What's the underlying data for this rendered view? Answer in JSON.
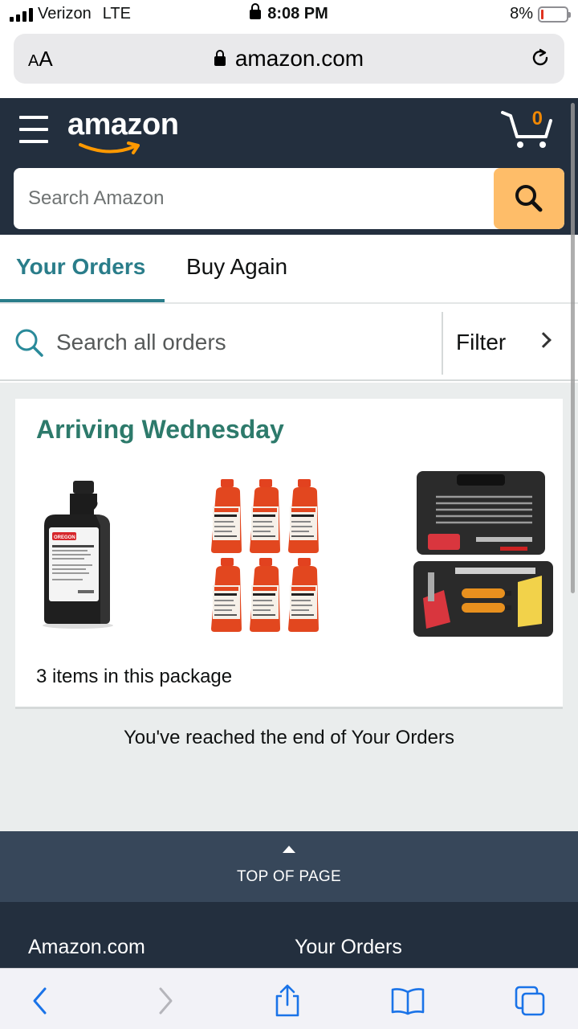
{
  "status_bar": {
    "carrier": "Verizon",
    "network": "LTE",
    "time": "8:08 PM",
    "battery_percent": "8%",
    "battery_level": 0.08
  },
  "browser": {
    "aa_label": "AA",
    "url": "amazon.com",
    "icons": [
      "lock-icon",
      "reload-icon"
    ]
  },
  "header": {
    "logo_text": "amazon",
    "cart_count": "0",
    "search_placeholder": "Search Amazon",
    "colors": {
      "header_bg": "#232f3e",
      "search_button": "#febd69",
      "cart_count": "#f08804"
    }
  },
  "tabs": [
    {
      "label": "Your Orders",
      "active": true
    },
    {
      "label": "Buy Again",
      "active": false
    }
  ],
  "order_search": {
    "placeholder": "Search all orders",
    "filter_label": "Filter"
  },
  "order": {
    "status": "Arriving Wednesday",
    "items": [
      {
        "name": "oregon-bar-chain-oil-bottle",
        "brand_label": "OREGON"
      },
      {
        "name": "stihl-two-stroke-oil-six-pack",
        "brand_label": "STIHL"
      },
      {
        "name": "chainsaw-sharpening-kit-case"
      }
    ],
    "items_count": "3 items in this package",
    "accent_color": "#2d7a6b"
  },
  "end_message": "You've reached the end of Your Orders",
  "footer": {
    "top_of_page": "TOP OF PAGE",
    "links": [
      "Amazon.com",
      "Your Orders"
    ]
  },
  "toolbar": {
    "buttons": [
      "back-icon",
      "forward-icon",
      "share-icon",
      "bookmarks-icon",
      "tabs-icon"
    ]
  }
}
